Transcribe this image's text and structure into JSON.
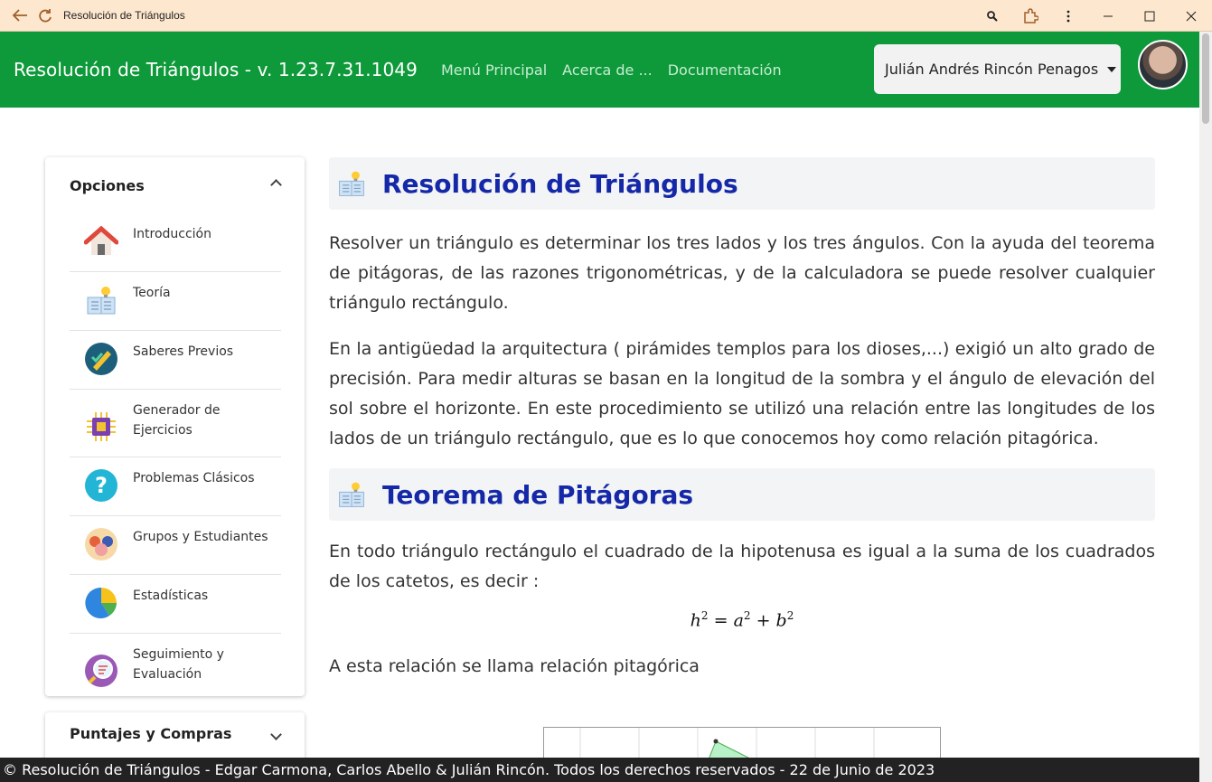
{
  "window": {
    "title": "Resolución de Triángulos"
  },
  "header": {
    "brand": "Resolución de Triángulos - v. 1.23.7.31.1049",
    "nav": [
      "Menú Principal",
      "Acerca de ...",
      "Documentación"
    ],
    "user": "Julián Andrés Rincón Penagos"
  },
  "sidebar": {
    "title": "Opciones",
    "items": [
      {
        "label": "Introducción",
        "icon": "house-icon"
      },
      {
        "label": "Teoría",
        "icon": "book-bulb-icon"
      },
      {
        "label": "Saberes Previos",
        "icon": "pencil-check-icon"
      },
      {
        "label": "Generador de Ejercicios",
        "icon": "chip-icon"
      },
      {
        "label": "Problemas Clásicos",
        "icon": "question-icon"
      },
      {
        "label": "Grupos y Estudiantes",
        "icon": "group-icon"
      },
      {
        "label": "Estadísticas",
        "icon": "pie-chart-icon"
      },
      {
        "label": "Seguimiento y Evaluación",
        "icon": "magnifier-report-icon"
      }
    ],
    "section2_title": "Puntajes y Compras"
  },
  "main": {
    "section1_title": "Resolución de Triángulos",
    "p1": "Resolver un triángulo es determinar los tres lados y los tres ángulos. Con la ayuda del teorema de pitágoras, de las razones trigonométricas, y de la calculadora se puede resolver cualquier triángulo rectángulo.",
    "p2": "En la antigüedad la arquitectura ( pirámides templos para los dioses,...) exigió un alto grado de precisión. Para medir alturas se basan en la longitud de la sombra y el ángulo de elevación del sol sobre el horizonte. En este procedimiento se utilizó una relación entre las longitudes de los lados de un triángulo rectángulo, que es lo que conocemos hoy como relación pitagórica.",
    "section2_title": "Teorema de Pitágoras",
    "p3": "En todo triángulo rectángulo el cuadrado de la hipotenusa es igual a la suma de los cuadrados de los catetos, es decir :",
    "formula": {
      "h": "h",
      "eq": "= ",
      "a": "a",
      "plus": " + ",
      "b": "b",
      "exp": "2"
    },
    "p4": "A esta relación se llama relación pitagórica"
  },
  "footer": {
    "text": "© Resolución de Triángulos - Edgar Carmona, Carlos Abello & Julián Rincón. Todos los derechos reservados - 22 de Junio de 2023"
  },
  "colors": {
    "appbar": "#0e9a3a",
    "heading": "#1428a8",
    "titlebar": "#fde7cf"
  }
}
